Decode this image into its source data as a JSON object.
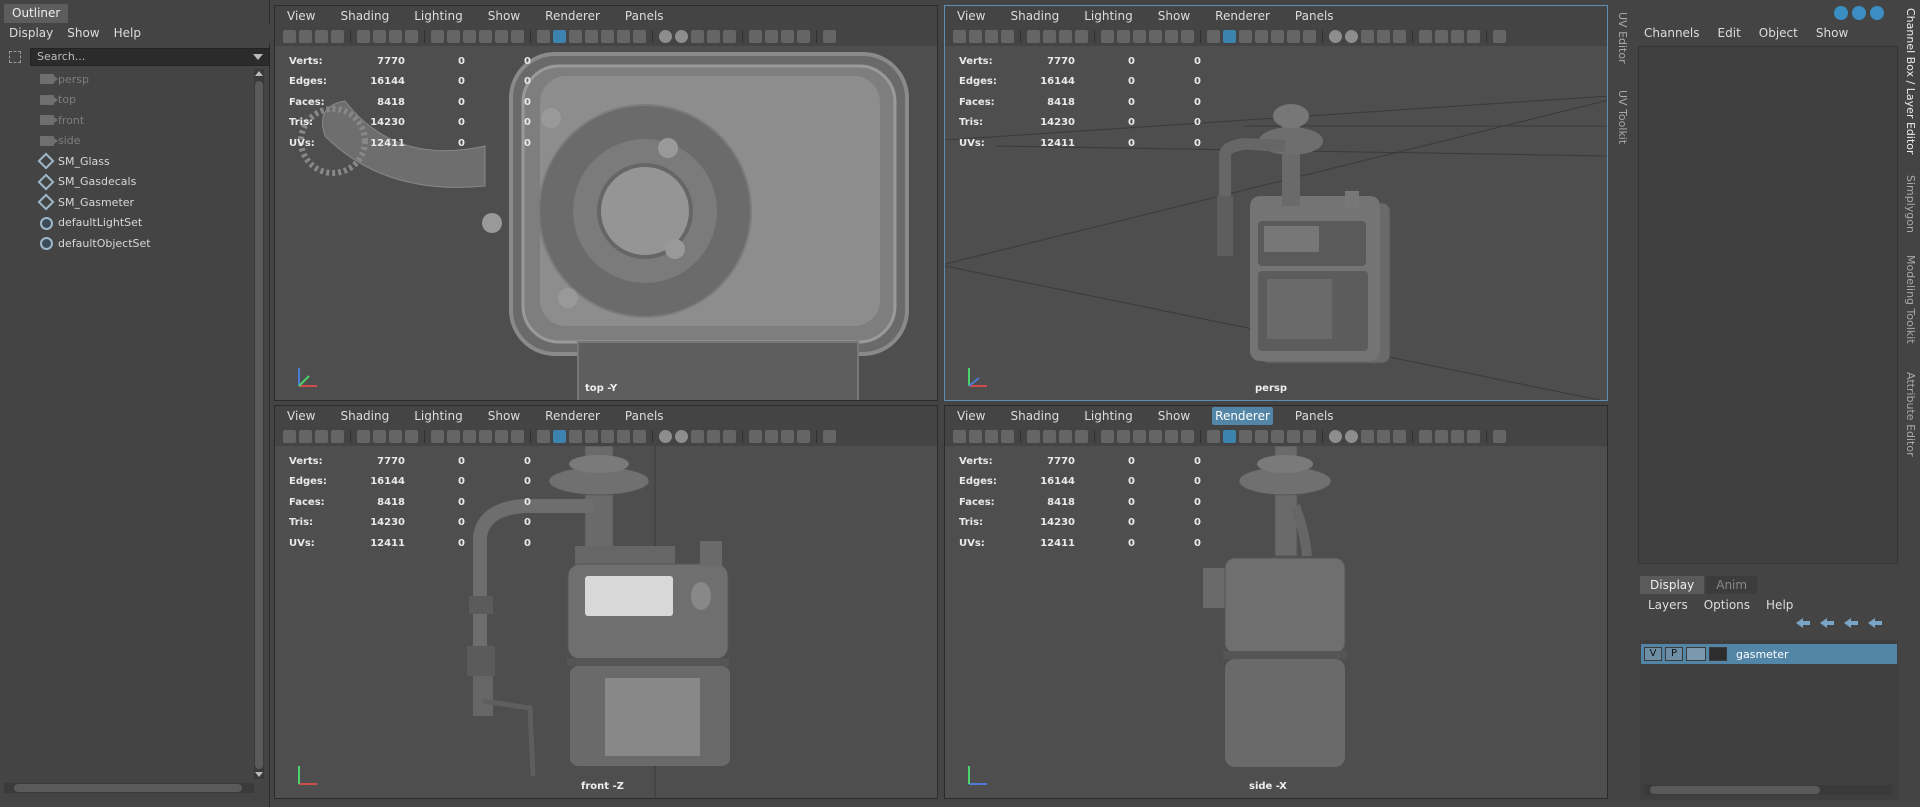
{
  "outliner": {
    "title": "Outliner",
    "menu": [
      "Display",
      "Show",
      "Help"
    ],
    "search_placeholder": "Search...",
    "items": [
      {
        "label": "persp",
        "icon": "camera-icon",
        "dim": true
      },
      {
        "label": "top",
        "icon": "camera-icon",
        "dim": true
      },
      {
        "label": "front",
        "icon": "camera-icon",
        "dim": true
      },
      {
        "label": "side",
        "icon": "camera-icon",
        "dim": true
      },
      {
        "label": "SM_Glass",
        "icon": "mesh-icon",
        "dim": false
      },
      {
        "label": "SM_Gasdecals",
        "icon": "mesh-icon",
        "dim": false
      },
      {
        "label": "SM_Gasmeter",
        "icon": "mesh-icon",
        "dim": false
      },
      {
        "label": "defaultLightSet",
        "icon": "set-icon",
        "dim": false
      },
      {
        "label": "defaultObjectSet",
        "icon": "set-icon",
        "dim": false
      }
    ]
  },
  "viewport_menu": [
    "View",
    "Shading",
    "Lighting",
    "Show",
    "Renderer",
    "Panels"
  ],
  "hud": {
    "rows": [
      {
        "key": "Verts:",
        "value": "7770",
        "a": "0",
        "b": "0"
      },
      {
        "key": "Edges:",
        "value": "16144",
        "a": "0",
        "b": "0"
      },
      {
        "key": "Faces:",
        "value": "8418",
        "a": "0",
        "b": "0"
      },
      {
        "key": "Tris:",
        "value": "14230",
        "a": "0",
        "b": "0"
      },
      {
        "key": "UVs:",
        "value": "12411",
        "a": "0",
        "b": "0"
      }
    ]
  },
  "viewports": {
    "top": {
      "label": "top -Y"
    },
    "persp": {
      "label": "persp"
    },
    "front": {
      "label": "front -Z"
    },
    "side": {
      "label": "side -X"
    }
  },
  "side_tabs_left": [
    "UV Editor",
    "UV Toolkit"
  ],
  "side_tabs_right": [
    "Channel Box / Layer Editor",
    "Simplygon",
    "Modeling Toolkit",
    "Attribute Editor"
  ],
  "channel_box": {
    "menu": [
      "Channels",
      "Edit",
      "Object",
      "Show"
    ],
    "tabs": [
      "Display",
      "Anim"
    ],
    "layer_menu": [
      "Layers",
      "Options",
      "Help"
    ],
    "layer": {
      "v": "V",
      "p": "P",
      "name": "gasmeter"
    }
  }
}
